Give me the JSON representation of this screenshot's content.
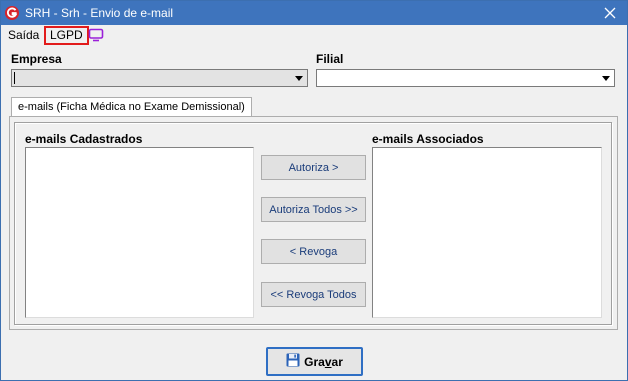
{
  "window": {
    "title": "SRH - Srh - Envio de e-mail",
    "app_icon": "app-logo-icon",
    "close_icon": "close-icon"
  },
  "menu": {
    "items": [
      {
        "label": "Saída"
      },
      {
        "label": "LGPD"
      }
    ],
    "screen_icon": "monitor-icon",
    "highlight_color": "#e21b1b"
  },
  "filters": {
    "empresa_label": "Empresa",
    "empresa_value": "",
    "filial_label": "Filial",
    "filial_value": ""
  },
  "tab": {
    "label": "e-mails (Ficha Médica no Exame Demissional)"
  },
  "lists": {
    "cadastrados_label": "e-mails Cadastrados",
    "associados_label": "e-mails Associados",
    "cadastrados_items": [],
    "associados_items": []
  },
  "actions": {
    "autoriza": "Autoriza >",
    "autoriza_todos": "Autoriza Todos >>",
    "revoga": "< Revoga",
    "revoga_todos": "<< Revoga Todos"
  },
  "footer": {
    "save_label_prefix": "Gra",
    "save_label_accel": "v",
    "save_label_suffix": "ar",
    "save_icon": "floppy-disk-icon"
  },
  "colors": {
    "titlebar": "#3e74bd",
    "accent": "#2f6fc4"
  }
}
